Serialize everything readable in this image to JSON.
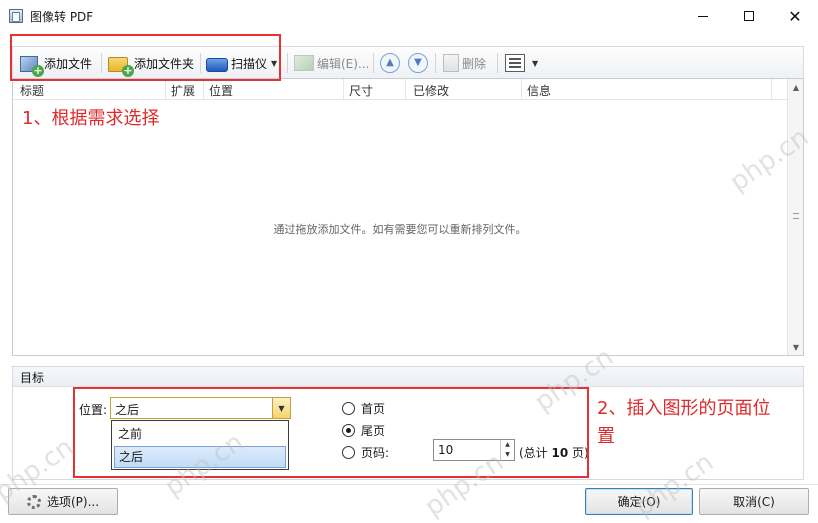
{
  "window": {
    "title": "图像转 PDF"
  },
  "toolbar": {
    "add_file": "添加文件",
    "add_folder": "添加文件夹",
    "scanner": "扫描仪",
    "edit": "编辑(E)...",
    "delete": "删除"
  },
  "grid": {
    "columns": [
      "标题",
      "扩展",
      "位置",
      "尺寸",
      "已修改",
      "信息"
    ],
    "empty_hint": "通过拖放添加文件。如有需要您可以重新排列文件。"
  },
  "target": {
    "title": "目标",
    "position_label": "位置:",
    "position_value": "之后",
    "position_options": [
      "之前",
      "之后"
    ],
    "radio_first": "首页",
    "radio_last": "尾页",
    "radio_page": "页码:",
    "selected_radio": "尾页",
    "page_number": "10",
    "total_prefix": "(总计",
    "total_count": "10",
    "total_suffix": "页)"
  },
  "annotations": {
    "step1": "1、根据需求选择",
    "step2_line1": "2、插入图形的页面位",
    "step2_line2": "置",
    "color": "#e53232"
  },
  "footer": {
    "options": "选项(P)...",
    "ok": "确定(O)",
    "cancel": "取消(C)"
  },
  "watermark": "php.cn"
}
